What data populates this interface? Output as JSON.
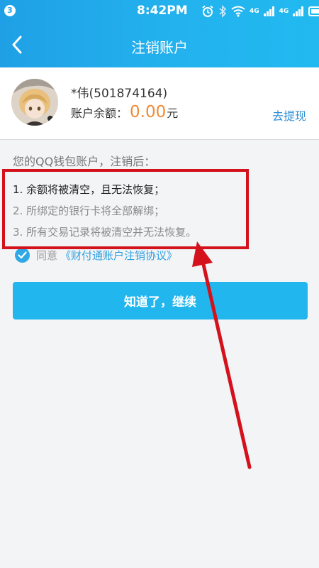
{
  "status_bar": {
    "notification_count": "3",
    "time": "8:42PM",
    "signal_1_label": "4G",
    "signal_2_label": "4G"
  },
  "header": {
    "title": "注销账户",
    "back_icon": "chevron-left-icon"
  },
  "account": {
    "name": "*伟(501874164)",
    "balance_label": "账户余额：",
    "balance_value": "0.00",
    "balance_unit": "元",
    "withdraw_label": "去提现"
  },
  "notice": {
    "heading": "您的QQ钱包账户，注销后：",
    "items": [
      "1. 余额将被清空，且无法恢复；",
      "2. 所绑定的银行卡将全部解绑；",
      "3. 所有交易记录将被清空并无法恢复。"
    ]
  },
  "agreement": {
    "checked": true,
    "label": "同意",
    "link_text": "《财付通账户注销协议》"
  },
  "continue_button": {
    "label": "知道了，继续"
  },
  "colors": {
    "header_blue": "#23b2ee",
    "balance_orange": "#f28a33",
    "link_blue": "#2e8fd3",
    "annotation_red": "#d3121c"
  }
}
